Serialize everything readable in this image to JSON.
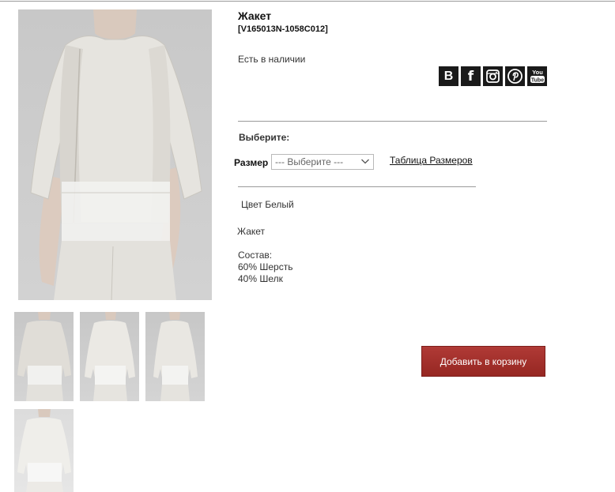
{
  "product": {
    "title": "Жакет",
    "sku": "[V165013N-1058C012]",
    "stock": "Есть в наличии",
    "choose_label": "Выберите:",
    "size_label": "Размер",
    "size_select_value": "--- Выберите ---",
    "size_table_link": "Таблица Размеров",
    "color": "Цвет Белый",
    "description": "Жакет",
    "composition": {
      "heading": "Состав:",
      "lines": [
        "60% Шерсть",
        "40% Шелк"
      ]
    },
    "add_to_cart": "Добавить в корзину"
  },
  "social": [
    {
      "icon": "vk-icon",
      "glyph": "B"
    },
    {
      "icon": "facebook-icon",
      "glyph": "f"
    },
    {
      "icon": "instagram-icon",
      "glyph": ""
    },
    {
      "icon": "pinterest-icon",
      "glyph": ""
    },
    {
      "icon": "youtube-icon",
      "glyph": ""
    }
  ],
  "gallery": {
    "main": "jacket-front-photo",
    "thumbnails": [
      "jacket-front",
      "jacket-three-quarter",
      "jacket-side",
      "jacket-front-light"
    ]
  },
  "colors": {
    "button": "#a3302c",
    "social_bg": "#1a1a1a",
    "divider": "#9a9a9a"
  }
}
